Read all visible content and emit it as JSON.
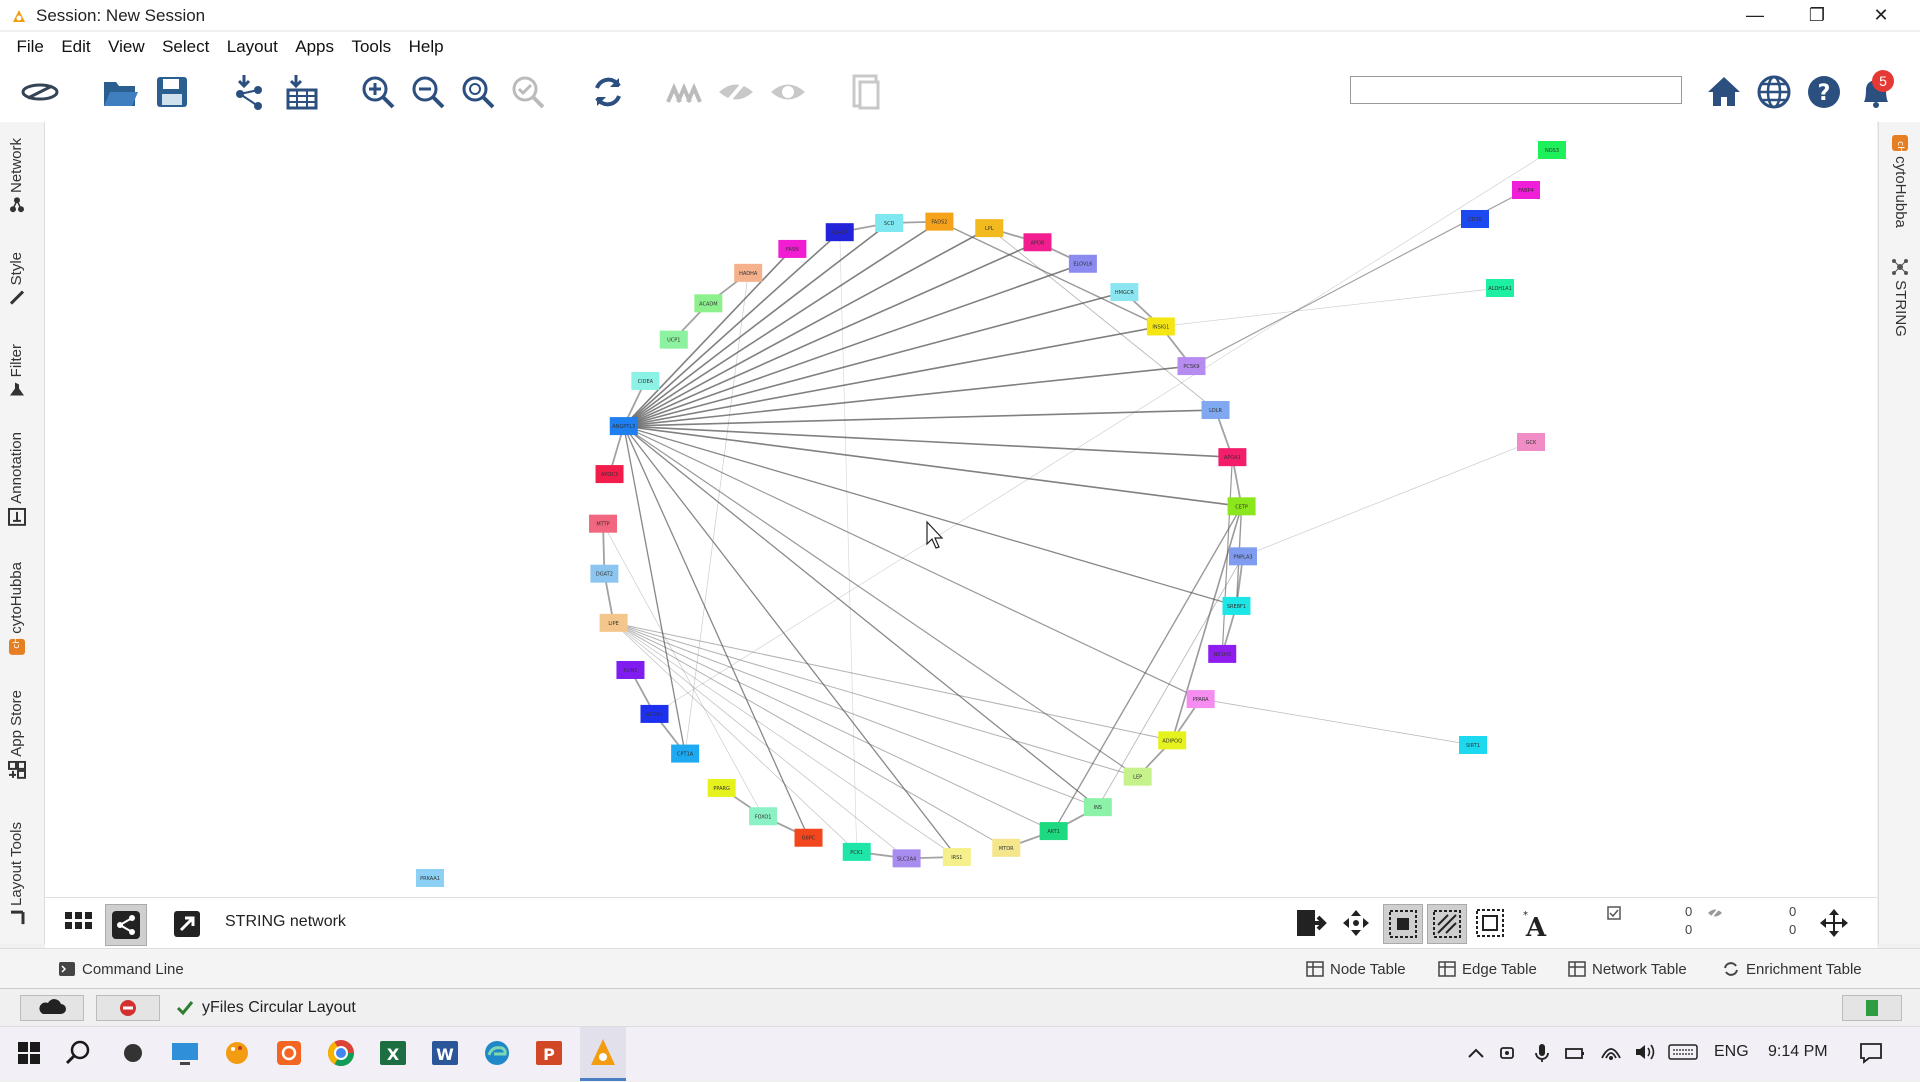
{
  "window": {
    "title": "Session: New Session",
    "minimize_glyph": "—",
    "restore_glyph": "❐",
    "close_glyph": "✕"
  },
  "menu": [
    "File",
    "Edit",
    "View",
    "Select",
    "Layout",
    "Apps",
    "Tools",
    "Help"
  ],
  "toolbar": {
    "icons": [
      "cytoscape-logo-icon",
      "open-folder-icon",
      "save-icon",
      "import-network-icon",
      "import-table-icon",
      "zoom-in-icon",
      "zoom-out-icon",
      "zoom-fit-icon",
      "zoom-selected-icon",
      "refresh-icon",
      "hide-selected-icon",
      "hide-icon",
      "show-all-icon",
      "new-network-icon"
    ],
    "search_value": "",
    "notification_count": "5",
    "right_icons": [
      "home-icon",
      "globe-icon",
      "help-icon",
      "bell-icon"
    ]
  },
  "left_tabs": [
    "Network",
    "Style",
    "Filter",
    "Annotation",
    "cytoHubba",
    "App Store",
    "Layout Tools"
  ],
  "right_tabs": [
    "cytoHubba",
    "STRING"
  ],
  "canvas": {
    "network_name": "STRING network",
    "selected_nodes": "0",
    "total_nodes": "0",
    "selected_edges": "0",
    "total_edges": "0",
    "node_labels": [
      "FASN",
      "ACACA",
      "SCD",
      "FADS2",
      "LPL",
      "APOB",
      "ELOVL6",
      "HMGCR",
      "INSIG1",
      "PCSK9",
      "LDLR",
      "APOA1",
      "CETP",
      "PNPLA3",
      "SREBF1",
      "NR1H3",
      "PPARA",
      "ADIPOQ",
      "LEP",
      "INS",
      "AKT1",
      "MTOR",
      "IRS1",
      "SLC2A4",
      "PCK1",
      "G6PC",
      "FOXO1",
      "PPARG",
      "CPT1A",
      "ACOX1",
      "PLIN1",
      "LIPE",
      "DGAT2",
      "MTTP",
      "APOC3",
      "ANGPTL3",
      "CIDEA",
      "UCP1",
      "ACADM",
      "HADHA",
      "FABP4",
      "CD36",
      "ALDH1A1",
      "GCK",
      "SIRT1",
      "PRKAA1",
      "NOS3",
      "TNF"
    ]
  },
  "bottom_tables": [
    "Command Line",
    "Node Table",
    "Edge Table",
    "Network Table",
    "Enrichment Table"
  ],
  "status": {
    "message": "yFiles Circular Layout"
  },
  "taskbar": {
    "language": "ENG",
    "time": "9:14 PM"
  },
  "colors": {
    "accent_red": "#e53935",
    "edge": "#555555"
  }
}
